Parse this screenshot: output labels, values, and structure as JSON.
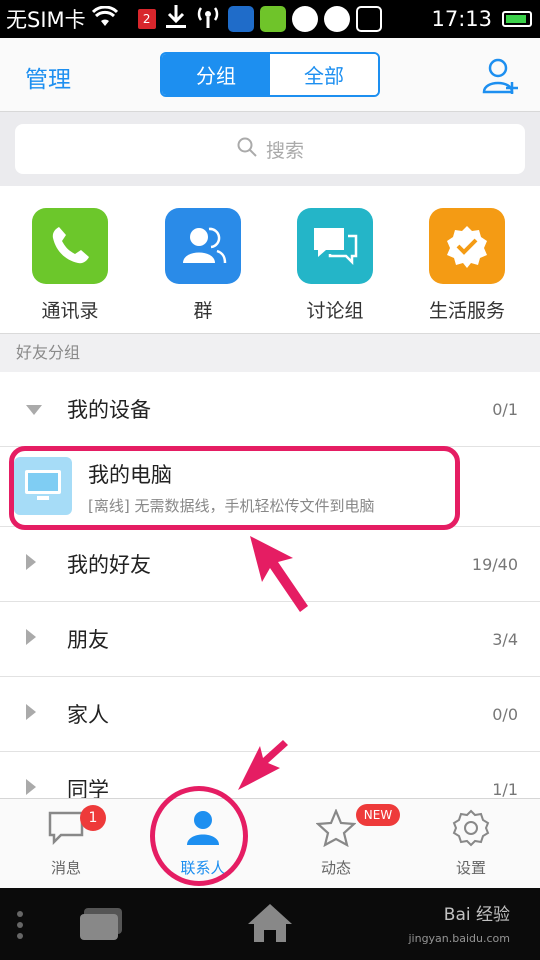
{
  "status_bar": {
    "carrier": "无SIM卡",
    "notification_count": "2",
    "time": "17:13"
  },
  "header": {
    "manage_label": "管理",
    "segments": [
      "分组",
      "全部"
    ],
    "active_segment": "分组"
  },
  "search": {
    "placeholder": "搜索"
  },
  "apps": [
    {
      "label": "通讯录",
      "icon": "phone-icon",
      "color": "#6cc72b"
    },
    {
      "label": "群",
      "icon": "group-icon",
      "color": "#2a8be8"
    },
    {
      "label": "讨论组",
      "icon": "discussion-icon",
      "color": "#24b5c8"
    },
    {
      "label": "生活服务",
      "icon": "service-badge-icon",
      "color": "#f49b14"
    }
  ],
  "section_title": "好友分组",
  "groups": {
    "my_devices": {
      "name": "我的设备",
      "count": "0/1",
      "expanded": true
    },
    "device": {
      "name": "我的电脑",
      "desc": "[离线] 无需数据线，手机轻松传文件到电脑"
    },
    "others": [
      {
        "name": "我的好友",
        "count": "19/40"
      },
      {
        "name": "朋友",
        "count": "3/4"
      },
      {
        "name": "家人",
        "count": "0/0"
      },
      {
        "name": "同学",
        "count": "1/1"
      }
    ]
  },
  "tabbar": {
    "tabs": [
      {
        "label": "消息",
        "icon": "chat-bubble-icon",
        "badge": "1"
      },
      {
        "label": "联系人",
        "icon": "person-icon",
        "active": true
      },
      {
        "label": "动态",
        "icon": "star-icon",
        "badge": "NEW"
      },
      {
        "label": "设置",
        "icon": "gear-icon"
      }
    ]
  },
  "watermark": {
    "brand": "Bai 经验",
    "url": "jingyan.baidu.com"
  },
  "colors": {
    "accent": "#1d8ff0",
    "highlight": "#e51d63",
    "badge": "#ee3a3a"
  }
}
